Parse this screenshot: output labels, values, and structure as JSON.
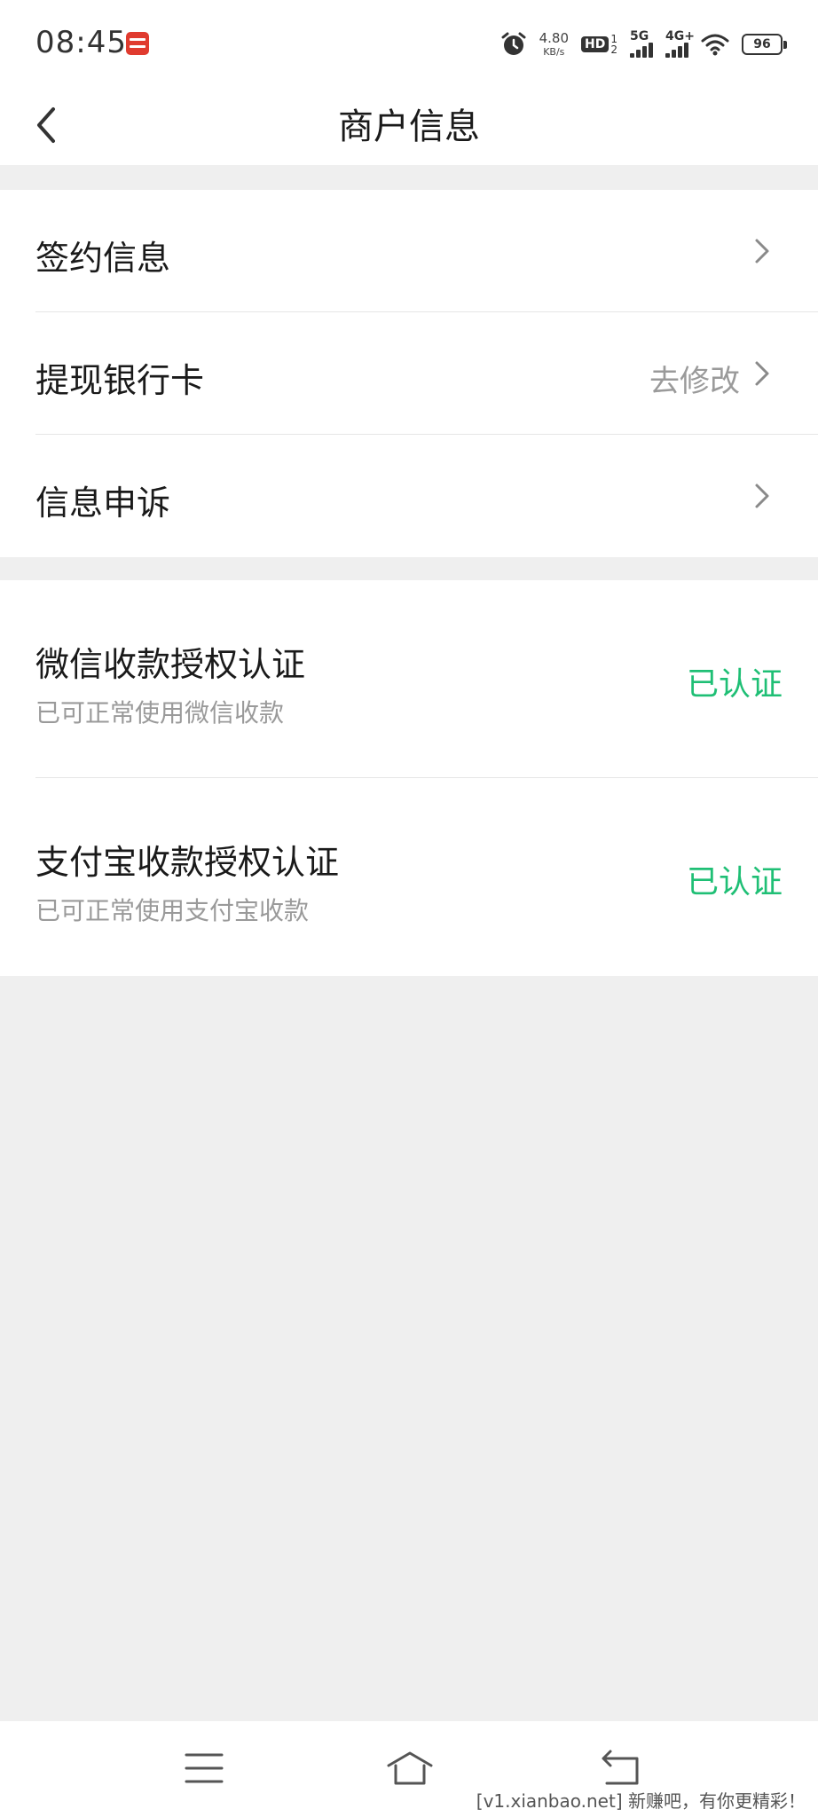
{
  "status_bar": {
    "time": "08:45",
    "net_speed_value": "4.80",
    "net_speed_unit": "KB/s",
    "hd_label": "HD",
    "hd_top": "1",
    "hd_bottom": "2",
    "signal_1_label": "5G",
    "signal_2_label": "4G+",
    "battery": "96"
  },
  "header": {
    "title": "商户信息"
  },
  "menu": {
    "items": [
      {
        "label": "签约信息",
        "action": ""
      },
      {
        "label": "提现银行卡",
        "action": "去修改"
      },
      {
        "label": "信息申诉",
        "action": ""
      }
    ]
  },
  "auth": {
    "items": [
      {
        "title": "微信收款授权认证",
        "subtitle": "已可正常使用微信收款",
        "status": "已认证"
      },
      {
        "title": "支付宝收款授权认证",
        "subtitle": "已可正常使用支付宝收款",
        "status": "已认证"
      }
    ]
  },
  "colors": {
    "accent_green": "#1fbf75",
    "secondary_text": "#9a9a9a",
    "background": "#efefef"
  },
  "nav": {
    "icons": [
      "menu-icon",
      "home-icon",
      "back-icon"
    ]
  },
  "watermark": "[v1.xianbao.net] 新赚吧，有你更精彩！"
}
